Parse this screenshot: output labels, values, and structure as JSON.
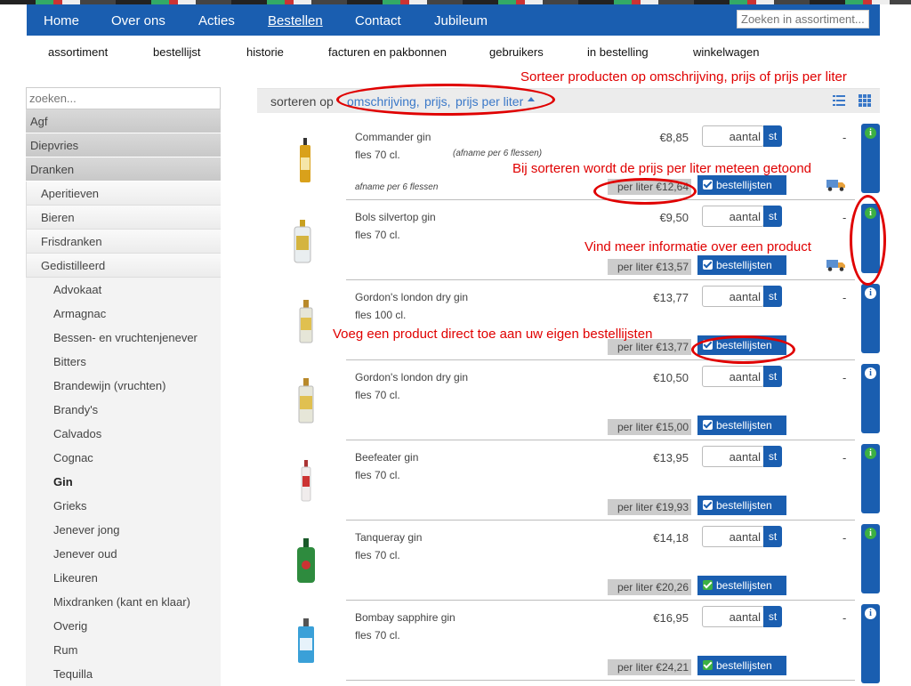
{
  "top_nav": {
    "items": [
      "Home",
      "Over ons",
      "Acties",
      "Bestellen",
      "Contact",
      "Jubileum"
    ],
    "active": "Bestellen",
    "search_placeholder": "Zoeken in assortiment..."
  },
  "sub_nav": [
    "assortiment",
    "bestellijst",
    "historie",
    "facturen en pakbonnen",
    "gebruikers",
    "in bestelling",
    "winkelwagen"
  ],
  "annotations": {
    "sort": "Sorteer producten op omschrijving, prijs of prijs per liter",
    "price_per_liter": "Bij sorteren wordt de prijs per liter meteen getoond",
    "info": "Vind meer informatie over een product",
    "lists": "Voeg een product direct toe aan uw eigen bestellijsten"
  },
  "sidebar": {
    "search_placeholder": "zoeken...",
    "level1": [
      "Agf",
      "Diepvries",
      "Dranken"
    ],
    "level2": [
      "Aperitieven",
      "Bieren",
      "Frisdranken",
      "Gedistilleerd"
    ],
    "level3": [
      "Advokaat",
      "Armagnac",
      "Bessen- en vruchtenjenever",
      "Bitters",
      "Brandewijn (vruchten)",
      "Brandy's",
      "Calvados",
      "Cognac",
      "Gin",
      "Grieks",
      "Jenever jong",
      "Jenever oud",
      "Likeuren",
      "Mixdranken (kant en klaar)",
      "Overig",
      "Rum",
      "Tequilla"
    ],
    "active_level3": "Gin"
  },
  "sort_bar": {
    "label": "sorteren op",
    "options": [
      "omschrijving,",
      "prijs,",
      "prijs per liter"
    ]
  },
  "products": [
    {
      "name": "Commander gin",
      "volume": "fles 70 cl.",
      "note": "(afname per 6 flessen)",
      "note2": "afname per 6 flessen",
      "price": "€8,85",
      "qty_placeholder": "aantal",
      "unit": "st",
      "per_liter": "per liter €12,64",
      "lists_label": "bestellijsten",
      "in_list": false,
      "stock": "-",
      "truck": true,
      "info_green": true
    },
    {
      "name": "Bols silvertop gin",
      "volume": "fles 70 cl.",
      "note": "",
      "note2": "",
      "price": "€9,50",
      "qty_placeholder": "aantal",
      "unit": "st",
      "per_liter": "per liter €13,57",
      "lists_label": "bestellijsten",
      "in_list": false,
      "stock": "-",
      "truck": true,
      "info_green": true
    },
    {
      "name": "Gordon's london dry gin",
      "volume": "fles 100 cl.",
      "note": "",
      "note2": "",
      "price": "€13,77",
      "qty_placeholder": "aantal",
      "unit": "st",
      "per_liter": "per liter €13,77",
      "lists_label": "bestellijsten",
      "in_list": false,
      "stock": "-",
      "truck": false,
      "info_green": false
    },
    {
      "name": "Gordon's london dry gin",
      "volume": "fles 70 cl.",
      "note": "",
      "note2": "",
      "price": "€10,50",
      "qty_placeholder": "aantal",
      "unit": "st",
      "per_liter": "per liter €15,00",
      "lists_label": "bestellijsten",
      "in_list": false,
      "stock": "-",
      "truck": false,
      "info_green": false
    },
    {
      "name": "Beefeater gin",
      "volume": "fles 70 cl.",
      "note": "",
      "note2": "",
      "price": "€13,95",
      "qty_placeholder": "aantal",
      "unit": "st",
      "per_liter": "per liter €19,93",
      "lists_label": "bestellijsten",
      "in_list": false,
      "stock": "-",
      "truck": false,
      "info_green": true
    },
    {
      "name": "Tanqueray gin",
      "volume": "fles 70 cl.",
      "note": "",
      "note2": "",
      "price": "€14,18",
      "qty_placeholder": "aantal",
      "unit": "st",
      "per_liter": "per liter €20,26",
      "lists_label": "bestellijsten",
      "in_list": true,
      "stock": "-",
      "truck": false,
      "info_green": true
    },
    {
      "name": "Bombay sapphire gin",
      "volume": "fles 70 cl.",
      "note": "",
      "note2": "",
      "price": "€16,95",
      "qty_placeholder": "aantal",
      "unit": "st",
      "per_liter": "per liter €24,21",
      "lists_label": "bestellijsten",
      "in_list": true,
      "stock": "-",
      "truck": false,
      "info_green": false
    }
  ],
  "colors": {
    "brand_blue": "#1a5eb0",
    "annotation_red": "#e00000",
    "info_green": "#3cb043"
  }
}
